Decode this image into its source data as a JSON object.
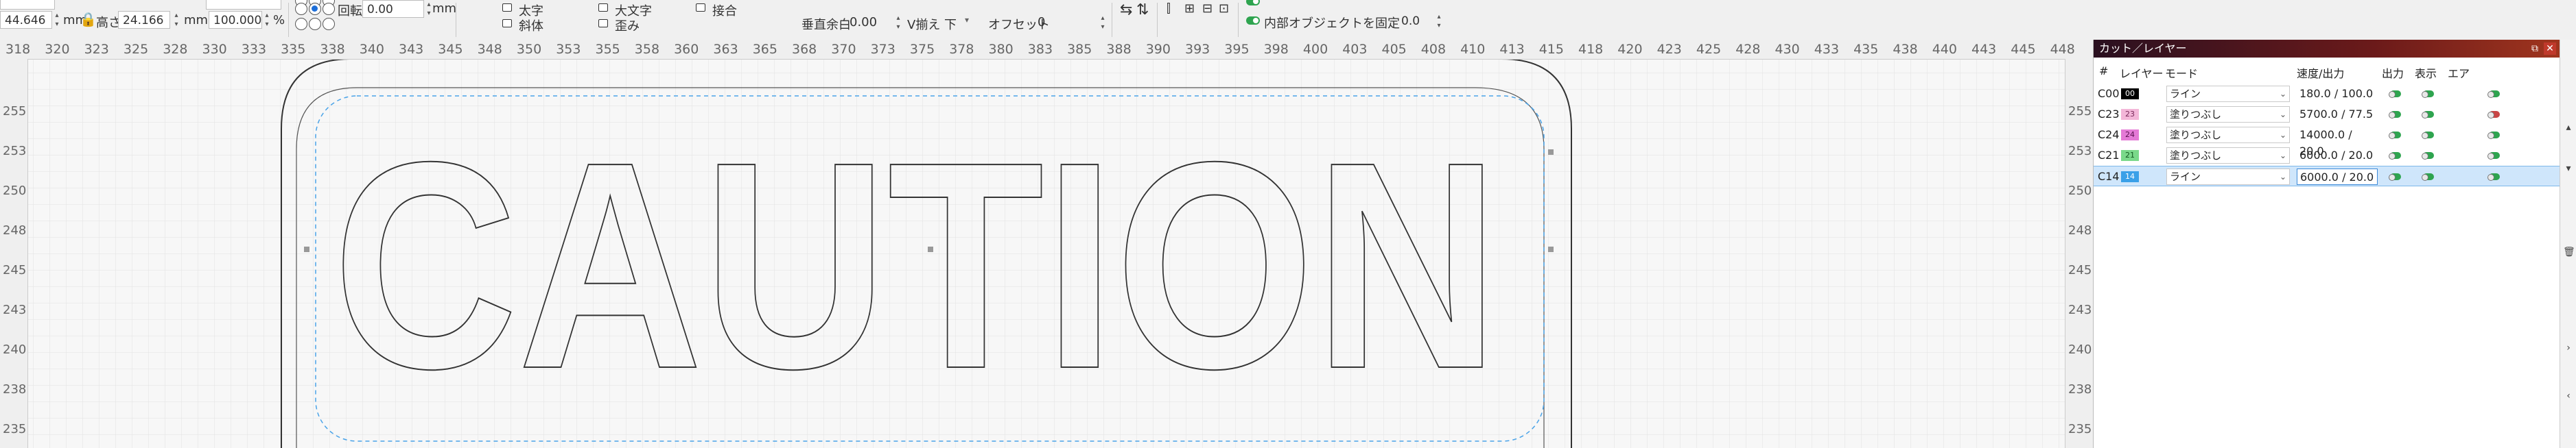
{
  "toolbar": {
    "x_value": "44.646",
    "unit_mm": "mm",
    "height_label": "高さ",
    "height_value": "24.166",
    "percent_value": "100.000",
    "percent_unit": "%",
    "rotate_label": "回転",
    "rotate_value": "0.00",
    "rotate_unit": "mm",
    "bold_label": "太字",
    "italic_label": "斜体",
    "upper_label": "大文字",
    "distort_label": "歪み",
    "weld_label": "接合",
    "vspace_label": "垂直余白",
    "vspace_value": "0.00",
    "valign_label": "V揃え",
    "valign_value": "下",
    "offset_label": "オフセット",
    "offset_value": "0",
    "lock_internal_label": "内部オブジェクトを固定",
    "lock_internal_value": "0.0"
  },
  "ruler": {
    "top": [
      "318",
      "320",
      "323",
      "325",
      "328",
      "330",
      "333",
      "335",
      "338",
      "340",
      "343",
      "345",
      "348",
      "350",
      "353",
      "355",
      "358",
      "360",
      "363",
      "365",
      "368",
      "370",
      "373",
      "375",
      "378",
      "380",
      "383",
      "385",
      "388",
      "390",
      "393",
      "395",
      "398",
      "400",
      "403",
      "405",
      "408",
      "410",
      "413",
      "415",
      "418",
      "420",
      "423",
      "425",
      "428",
      "430",
      "433",
      "435",
      "438",
      "440",
      "443",
      "445",
      "448"
    ],
    "left": [
      "255",
      "253",
      "250",
      "248",
      "245",
      "243",
      "240",
      "238",
      "235"
    ],
    "right": [
      "255",
      "253",
      "250",
      "248",
      "245",
      "243",
      "240",
      "238",
      "235"
    ]
  },
  "canvas_text": "CAUTION",
  "panel": {
    "title": "カット／レイヤー",
    "head_num": "#",
    "head_layer": "レイヤー",
    "head_mode": "モード",
    "head_speed": "速度/出力",
    "head_output": "出力",
    "head_show": "表示",
    "head_air": "エア",
    "rows": [
      {
        "id": "C00",
        "swatch": "00",
        "swatch_bg": "#000000",
        "swatch_fg": "#ffffff",
        "mode": "ライン",
        "speed": "180.0 / 100.0",
        "air": "green"
      },
      {
        "id": "C23",
        "swatch": "23",
        "swatch_bg": "#f3b6d8",
        "swatch_fg": "#7a2a5a",
        "mode": "塗りつぶし",
        "speed": "5700.0 / 77.5",
        "air": "red"
      },
      {
        "id": "C24",
        "swatch": "24",
        "swatch_bg": "#e47ad6",
        "swatch_fg": "#5a1050",
        "mode": "塗りつぶし",
        "speed": "14000.0 / 20.0",
        "air": "green"
      },
      {
        "id": "C21",
        "swatch": "21",
        "swatch_bg": "#7ad98a",
        "swatch_fg": "#145a22",
        "mode": "塗りつぶし",
        "speed": "6000.0 / 20.0",
        "air": "green"
      },
      {
        "id": "C14",
        "swatch": "14",
        "swatch_bg": "#3aa0e8",
        "swatch_fg": "#ffffff",
        "mode": "ライン",
        "speed": "6000.0 / 20.0",
        "air": "green"
      }
    ]
  }
}
